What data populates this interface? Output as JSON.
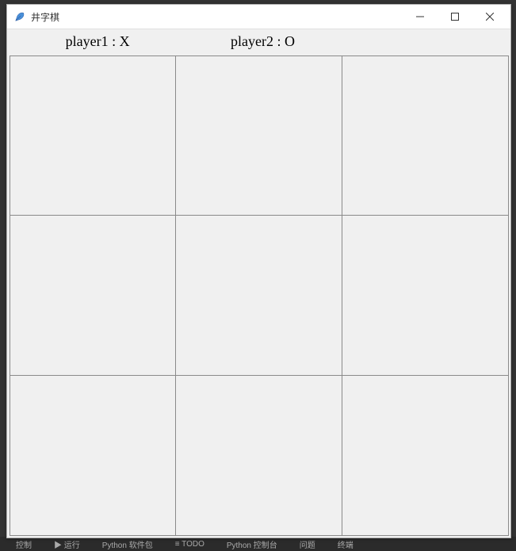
{
  "window": {
    "title": "井字棋",
    "icon_name": "feather-icon"
  },
  "controls": {
    "minimize": "–",
    "maximize": "□",
    "close": "✕"
  },
  "players": {
    "p1_label": "player1 : X",
    "p2_label": "player2 : O"
  },
  "board": {
    "size": 3,
    "cells": [
      [
        "",
        "",
        ""
      ],
      [
        "",
        "",
        ""
      ],
      [
        "",
        "",
        ""
      ]
    ]
  },
  "background_ide": {
    "items": [
      "控制",
      "▶ 运行",
      "Python 软件包",
      "≡ TODO",
      "Python 控制台",
      "问题",
      "终端"
    ]
  }
}
